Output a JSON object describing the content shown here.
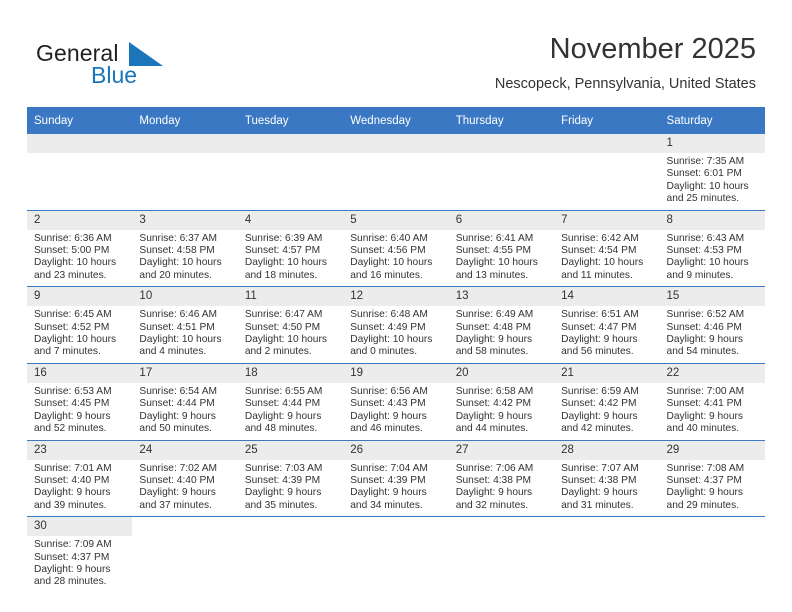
{
  "brand": {
    "name_top": "General",
    "name_bottom": "Blue",
    "flag_icon": "blue-triangle-flag-icon",
    "color_dark": "#231f20",
    "color_blue": "#1b75bb"
  },
  "header": {
    "title": "November 2025",
    "subtitle": "Nescopeck, Pennsylvania, United States"
  },
  "theme": {
    "header_blue": "#3b78c3",
    "daynum_band": "#ececec",
    "text": "#333333"
  },
  "calendar": {
    "weekday_headers": [
      "Sunday",
      "Monday",
      "Tuesday",
      "Wednesday",
      "Thursday",
      "Friday",
      "Saturday"
    ],
    "weeks": [
      [
        {
          "day": "",
          "blank": true
        },
        {
          "day": "",
          "blank": true
        },
        {
          "day": "",
          "blank": true
        },
        {
          "day": "",
          "blank": true
        },
        {
          "day": "",
          "blank": true
        },
        {
          "day": "",
          "blank": true
        },
        {
          "day": "1",
          "sunrise": "Sunrise: 7:35 AM",
          "sunset": "Sunset: 6:01 PM",
          "daylight_1": "Daylight: 10 hours",
          "daylight_2": "and 25 minutes."
        }
      ],
      [
        {
          "day": "2",
          "sunrise": "Sunrise: 6:36 AM",
          "sunset": "Sunset: 5:00 PM",
          "daylight_1": "Daylight: 10 hours",
          "daylight_2": "and 23 minutes."
        },
        {
          "day": "3",
          "sunrise": "Sunrise: 6:37 AM",
          "sunset": "Sunset: 4:58 PM",
          "daylight_1": "Daylight: 10 hours",
          "daylight_2": "and 20 minutes."
        },
        {
          "day": "4",
          "sunrise": "Sunrise: 6:39 AM",
          "sunset": "Sunset: 4:57 PM",
          "daylight_1": "Daylight: 10 hours",
          "daylight_2": "and 18 minutes."
        },
        {
          "day": "5",
          "sunrise": "Sunrise: 6:40 AM",
          "sunset": "Sunset: 4:56 PM",
          "daylight_1": "Daylight: 10 hours",
          "daylight_2": "and 16 minutes."
        },
        {
          "day": "6",
          "sunrise": "Sunrise: 6:41 AM",
          "sunset": "Sunset: 4:55 PM",
          "daylight_1": "Daylight: 10 hours",
          "daylight_2": "and 13 minutes."
        },
        {
          "day": "7",
          "sunrise": "Sunrise: 6:42 AM",
          "sunset": "Sunset: 4:54 PM",
          "daylight_1": "Daylight: 10 hours",
          "daylight_2": "and 11 minutes."
        },
        {
          "day": "8",
          "sunrise": "Sunrise: 6:43 AM",
          "sunset": "Sunset: 4:53 PM",
          "daylight_1": "Daylight: 10 hours",
          "daylight_2": "and 9 minutes."
        }
      ],
      [
        {
          "day": "9",
          "sunrise": "Sunrise: 6:45 AM",
          "sunset": "Sunset: 4:52 PM",
          "daylight_1": "Daylight: 10 hours",
          "daylight_2": "and 7 minutes."
        },
        {
          "day": "10",
          "sunrise": "Sunrise: 6:46 AM",
          "sunset": "Sunset: 4:51 PM",
          "daylight_1": "Daylight: 10 hours",
          "daylight_2": "and 4 minutes."
        },
        {
          "day": "11",
          "sunrise": "Sunrise: 6:47 AM",
          "sunset": "Sunset: 4:50 PM",
          "daylight_1": "Daylight: 10 hours",
          "daylight_2": "and 2 minutes."
        },
        {
          "day": "12",
          "sunrise": "Sunrise: 6:48 AM",
          "sunset": "Sunset: 4:49 PM",
          "daylight_1": "Daylight: 10 hours",
          "daylight_2": "and 0 minutes."
        },
        {
          "day": "13",
          "sunrise": "Sunrise: 6:49 AM",
          "sunset": "Sunset: 4:48 PM",
          "daylight_1": "Daylight: 9 hours",
          "daylight_2": "and 58 minutes."
        },
        {
          "day": "14",
          "sunrise": "Sunrise: 6:51 AM",
          "sunset": "Sunset: 4:47 PM",
          "daylight_1": "Daylight: 9 hours",
          "daylight_2": "and 56 minutes."
        },
        {
          "day": "15",
          "sunrise": "Sunrise: 6:52 AM",
          "sunset": "Sunset: 4:46 PM",
          "daylight_1": "Daylight: 9 hours",
          "daylight_2": "and 54 minutes."
        }
      ],
      [
        {
          "day": "16",
          "sunrise": "Sunrise: 6:53 AM",
          "sunset": "Sunset: 4:45 PM",
          "daylight_1": "Daylight: 9 hours",
          "daylight_2": "and 52 minutes."
        },
        {
          "day": "17",
          "sunrise": "Sunrise: 6:54 AM",
          "sunset": "Sunset: 4:44 PM",
          "daylight_1": "Daylight: 9 hours",
          "daylight_2": "and 50 minutes."
        },
        {
          "day": "18",
          "sunrise": "Sunrise: 6:55 AM",
          "sunset": "Sunset: 4:44 PM",
          "daylight_1": "Daylight: 9 hours",
          "daylight_2": "and 48 minutes."
        },
        {
          "day": "19",
          "sunrise": "Sunrise: 6:56 AM",
          "sunset": "Sunset: 4:43 PM",
          "daylight_1": "Daylight: 9 hours",
          "daylight_2": "and 46 minutes."
        },
        {
          "day": "20",
          "sunrise": "Sunrise: 6:58 AM",
          "sunset": "Sunset: 4:42 PM",
          "daylight_1": "Daylight: 9 hours",
          "daylight_2": "and 44 minutes."
        },
        {
          "day": "21",
          "sunrise": "Sunrise: 6:59 AM",
          "sunset": "Sunset: 4:42 PM",
          "daylight_1": "Daylight: 9 hours",
          "daylight_2": "and 42 minutes."
        },
        {
          "day": "22",
          "sunrise": "Sunrise: 7:00 AM",
          "sunset": "Sunset: 4:41 PM",
          "daylight_1": "Daylight: 9 hours",
          "daylight_2": "and 40 minutes."
        }
      ],
      [
        {
          "day": "23",
          "sunrise": "Sunrise: 7:01 AM",
          "sunset": "Sunset: 4:40 PM",
          "daylight_1": "Daylight: 9 hours",
          "daylight_2": "and 39 minutes."
        },
        {
          "day": "24",
          "sunrise": "Sunrise: 7:02 AM",
          "sunset": "Sunset: 4:40 PM",
          "daylight_1": "Daylight: 9 hours",
          "daylight_2": "and 37 minutes."
        },
        {
          "day": "25",
          "sunrise": "Sunrise: 7:03 AM",
          "sunset": "Sunset: 4:39 PM",
          "daylight_1": "Daylight: 9 hours",
          "daylight_2": "and 35 minutes."
        },
        {
          "day": "26",
          "sunrise": "Sunrise: 7:04 AM",
          "sunset": "Sunset: 4:39 PM",
          "daylight_1": "Daylight: 9 hours",
          "daylight_2": "and 34 minutes."
        },
        {
          "day": "27",
          "sunrise": "Sunrise: 7:06 AM",
          "sunset": "Sunset: 4:38 PM",
          "daylight_1": "Daylight: 9 hours",
          "daylight_2": "and 32 minutes."
        },
        {
          "day": "28",
          "sunrise": "Sunrise: 7:07 AM",
          "sunset": "Sunset: 4:38 PM",
          "daylight_1": "Daylight: 9 hours",
          "daylight_2": "and 31 minutes."
        },
        {
          "day": "29",
          "sunrise": "Sunrise: 7:08 AM",
          "sunset": "Sunset: 4:37 PM",
          "daylight_1": "Daylight: 9 hours",
          "daylight_2": "and 29 minutes."
        }
      ],
      [
        {
          "day": "30",
          "sunrise": "Sunrise: 7:09 AM",
          "sunset": "Sunset: 4:37 PM",
          "daylight_1": "Daylight: 9 hours",
          "daylight_2": "and 28 minutes."
        },
        {
          "day": "",
          "filler": true
        },
        {
          "day": "",
          "filler": true
        },
        {
          "day": "",
          "filler": true
        },
        {
          "day": "",
          "filler": true
        },
        {
          "day": "",
          "filler": true
        },
        {
          "day": "",
          "filler": true
        }
      ]
    ]
  }
}
